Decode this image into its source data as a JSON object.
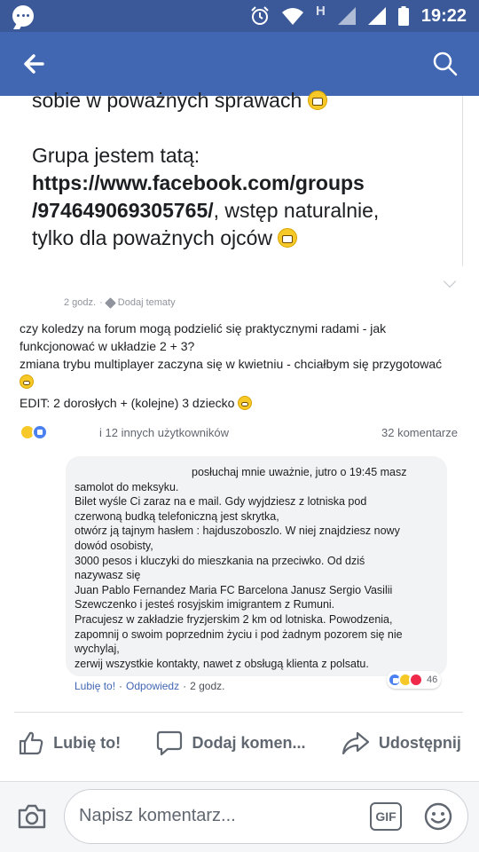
{
  "status_bar": {
    "network_letter": "H",
    "time": "19:22"
  },
  "icons": {
    "messenger": "messenger-icon",
    "alarm": "alarm-icon",
    "wifi": "wifi-icon",
    "back": "arrow-left-icon",
    "search": "search-icon",
    "tag": "tag-icon",
    "like": "thumbs-up-icon",
    "comment": "speech-bubble-icon",
    "share": "share-arrow-icon",
    "camera": "camera-icon",
    "gif": "gif-icon",
    "emoji": "smiley-icon"
  },
  "colors": {
    "brand": "#4267b2",
    "status_bar": "#3b5998",
    "link": "#4267b2"
  },
  "post": {
    "line1": "sobie w poważnych sprawach",
    "line2": "Grupa jestem tatą:",
    "link_line1": "https://www.facebook.com/groups",
    "link_line2": "/974649069305765/",
    "after_link": ", wstęp naturalnie,",
    "line_last": "tylko dla poważnych ojców"
  },
  "shared": {
    "time": "2 godz.",
    "add_topics": "Dodaj tematy",
    "text1": "czy koledzy na forum mogą podzielić się praktycznymi radami - jak funkcjonować w układzie 2 + 3?",
    "text2": "zmiana trybu multiplayer zaczyna się w kwietniu - chciałbym się przygotować",
    "text3": "EDIT: 2 dorosłych + (kolejne) 3 dziecko",
    "reactions_others": "i 12 innych użytkowników",
    "comments_count": "32 komentarze"
  },
  "comment": {
    "text": "posłuchaj mnie uważnie, jutro o 19:45 masz\nsamolot do meksyku.\nBilet wyśle Ci zaraz na e mail. Gdy wyjdziesz z lotniska pod\nczerwoną budką telefoniczną jest skrytka,\notwórz ją tajnym hasłem : hajduszoboszlo. W niej znajdziesz nowy\ndowód osobisty,\n3000 pesos i kluczyki do mieszkania na przeciwko. Od dziś\nnazywasz się\nJuan Pablo Fernandez Maria FC Barcelona Janusz Sergio Vasilii\nSzewczenko i jesteś rosyjskim imigrantem z Rumuni.\nPracujesz w zakładzie fryzjerskim 2 km od lotniska. Powodzenia,\nzapomnij o swoim poprzednim życiu i pod żadnym pozorem się nie\nwychylaj,\nzerwij wszystkie kontakty, nawet z obsługą klienta z polsatu.",
    "like_label": "Lubię to!",
    "separator": "·",
    "reply_label": "Odpowiedz",
    "time": "2 godz.",
    "reaction_count": "46"
  },
  "action_bar": {
    "like": "Lubię to!",
    "comment": "Dodaj komen...",
    "share": "Udostępnij"
  },
  "composer": {
    "placeholder": "Napisz komentarz...",
    "gif": "GIF"
  }
}
